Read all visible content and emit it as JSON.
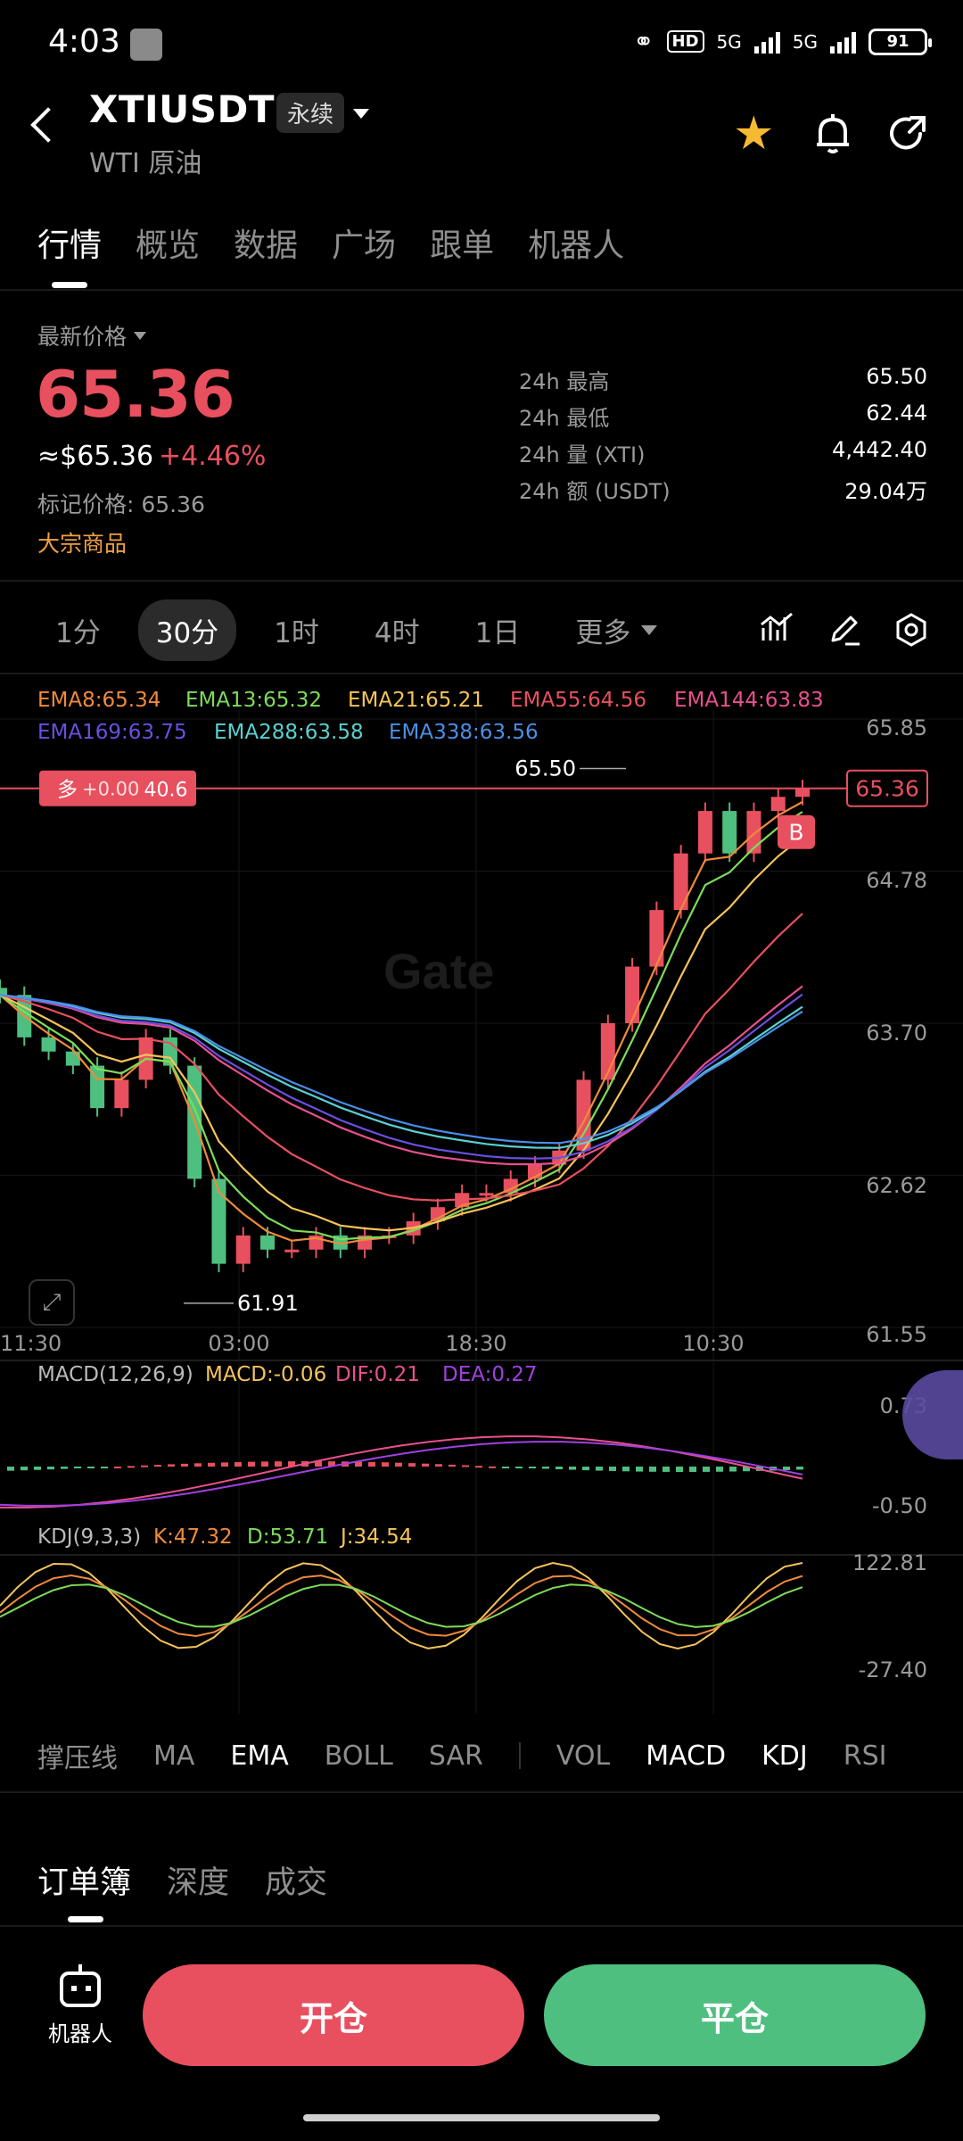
{
  "status": {
    "time": "4:03",
    "hd": "HD",
    "net1": "5G",
    "net2": "5G",
    "battery": "91"
  },
  "header": {
    "symbol": "XTIUSDT",
    "tag": "永续",
    "subtitle": "WTI 原油"
  },
  "tabs": [
    "行情",
    "概览",
    "数据",
    "广场",
    "跟单",
    "机器人"
  ],
  "price": {
    "label": "最新价格",
    "last": "65.36",
    "usd": "≈$65.36",
    "change": "+4.46%",
    "mark": "标记价格: 65.36",
    "category": "大宗商品",
    "stats": [
      {
        "k": "24h  最高",
        "v": "65.50"
      },
      {
        "k": "24h  最低",
        "v": "62.44"
      },
      {
        "k": "24h  量 (XTI)",
        "v": "4,442.40"
      },
      {
        "k": "24h  额 (USDT)",
        "v": "29.04万"
      }
    ]
  },
  "intervals": {
    "items": [
      "1分",
      "30分",
      "1时",
      "4时",
      "1日"
    ],
    "more": "更多"
  },
  "chart": {
    "ema_legend": [
      {
        "text": "EMA8:65.34",
        "color": "#f08a3c"
      },
      {
        "text": "EMA13:65.32",
        "color": "#7ddc5a"
      },
      {
        "text": "EMA21:65.21",
        "color": "#f5c45a"
      },
      {
        "text": "EMA55:64.56",
        "color": "#e8505f"
      },
      {
        "text": "EMA144:63.83",
        "color": "#e8508f"
      },
      {
        "text": "EMA169:63.75",
        "color": "#6b4fe0"
      },
      {
        "text": "EMA288:63.58",
        "color": "#5ad0d0"
      },
      {
        "text": "EMA338:63.56",
        "color": "#4a8fe8"
      }
    ],
    "position": {
      "side": "多",
      "pnl": "+0.00",
      "qty": "40.6"
    },
    "price_ticks": [
      "65.85",
      "64.78",
      "63.70",
      "62.62",
      "61.55"
    ],
    "current_price": "65.36",
    "high_label": "65.50",
    "low_label": "61.91",
    "b_marker": "B",
    "watermark": "Gate",
    "time_ticks": [
      "11:30",
      "03:00",
      "18:30",
      "10:30"
    ],
    "macd_label": "MACD(12,26,9)",
    "macd_vals": [
      {
        "text": "MACD:-0.06",
        "color": "#f5c45a"
      },
      {
        "text": "DIF:0.21",
        "color": "#e8508f"
      },
      {
        "text": "DEA:0.27",
        "color": "#a040e0"
      }
    ],
    "macd_ticks": [
      "0.73",
      "-0.50"
    ],
    "kdj_label": "KDJ(9,3,3)",
    "kdj_vals": [
      {
        "text": "K:47.32",
        "color": "#f08a3c"
      },
      {
        "text": "D:53.71",
        "color": "#7ddc5a"
      },
      {
        "text": "J:34.54",
        "color": "#f5c45a"
      }
    ],
    "kdj_ticks": [
      "122.81",
      "-27.40"
    ]
  },
  "chart_data": {
    "type": "candlestick",
    "interval": "30分",
    "y_range": [
      61.55,
      65.85
    ],
    "high": 65.5,
    "low": 61.91,
    "last": 65.36,
    "closes": [
      63.9,
      63.6,
      63.5,
      63.4,
      63.1,
      63.3,
      63.6,
      63.4,
      62.6,
      62.0,
      62.2,
      62.1,
      62.1,
      62.2,
      62.1,
      62.2,
      62.2,
      62.3,
      62.4,
      62.5,
      62.5,
      62.6,
      62.7,
      62.8,
      63.3,
      63.7,
      64.1,
      64.5,
      64.9,
      65.2,
      64.9,
      65.2,
      65.3,
      65.36
    ]
  },
  "indicators": {
    "main": [
      "撑压线",
      "MA",
      "EMA",
      "BOLL",
      "SAR"
    ],
    "sub": [
      "VOL",
      "MACD",
      "KDJ",
      "RSI"
    ],
    "active": [
      "EMA",
      "MACD",
      "KDJ"
    ]
  },
  "orderbook_tabs": [
    "订单簿",
    "深度",
    "成交"
  ],
  "bottom": {
    "robot": "机器人",
    "open": "开仓",
    "close": "平仓"
  },
  "colors": {
    "up": "#e8505f",
    "down": "#4fbf7f",
    "accent": "#f5b932"
  }
}
